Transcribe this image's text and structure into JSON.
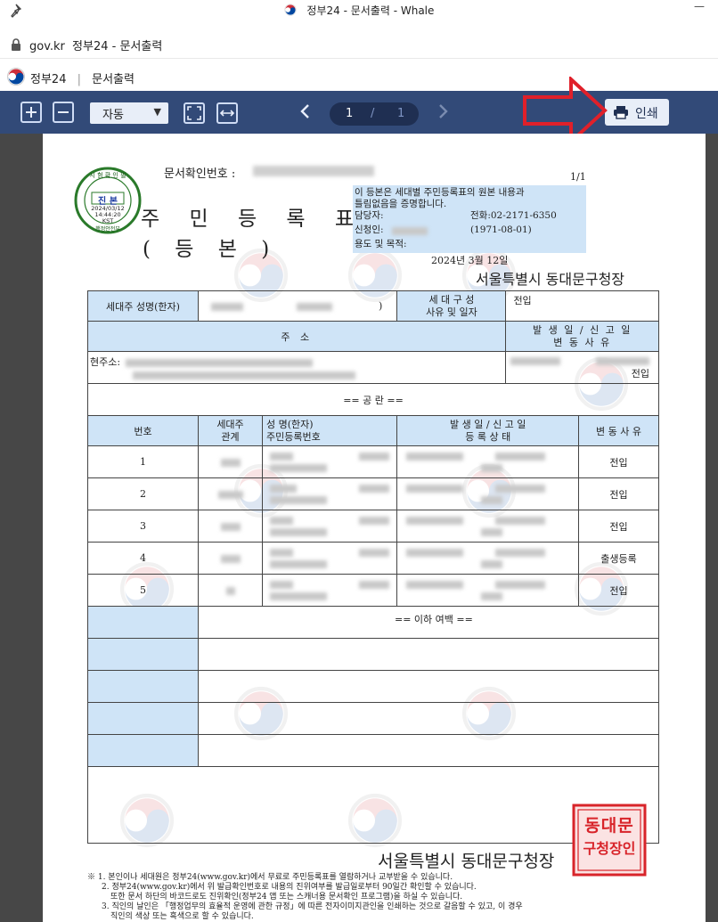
{
  "window": {
    "title": "정부24 - 문서출력 - Whale",
    "minimize": "—"
  },
  "address_bar": {
    "url": "gov.kr",
    "page_title": "정부24 - 문서출력"
  },
  "app_header": {
    "site": "정부24",
    "section": "문서출력"
  },
  "toolbar": {
    "zoom_value": "자동",
    "page_current": "1",
    "page_separator": "/",
    "page_total": "1",
    "print_label": "인쇄",
    "highlight_color": "#e0202a"
  },
  "document": {
    "doc_no_label": "문서확인번호 :",
    "page_count": "1/1",
    "title": "주 민 등 록 표",
    "subtitle": "( 등        본 )",
    "seal_round": {
      "l1": "시 험 확 인 필",
      "l2": "진 본",
      "l3": "2024/03/12",
      "l4": "14:44:20",
      "l5": "KST",
      "l6": "행정안전부"
    },
    "cert_text_1": "이 등본은 세대별 주민등록표의 원본 내용과",
    "cert_text_2": "틀림없음을 증명합니다.",
    "staff_label": "담당자:",
    "phone_label": "전화:02-2171-6350",
    "applicant_label": "신청인:",
    "applicant_birth": "(1971-08-01)",
    "purpose_label": "용도 및 목적:",
    "issue_date": "2024년 3월 12일",
    "office": "서울특별시 동대문구청장",
    "head_name_label": "세대주 성명(한자)",
    "head_name_paren": ")",
    "household_reason_label_1": "세 대 구 성",
    "household_reason_label_2": "사유 및 일자",
    "household_reason_value": "전입",
    "address_header": "주          소",
    "address_date_header_1": "발 생 일  /  신 고 일",
    "address_date_header_2": "변   동    사   유",
    "current_address_label": "현주소:",
    "address_reason_tail": "전입",
    "empty_row_text": "==  공    란  ==",
    "members_header": {
      "no": "번호",
      "relation_1": "세대주",
      "relation_2": "관계",
      "name_1": "성  명(한자)",
      "name_2": "주민등록번호",
      "date_1": "발 생 일  /  신 고 일",
      "date_2": "등 록 상 태",
      "reason": "변 동 사 유"
    },
    "members": [
      {
        "no": "1",
        "reason": "전입"
      },
      {
        "no": "2",
        "reason": "전입"
      },
      {
        "no": "3",
        "reason": "전입"
      },
      {
        "no": "4",
        "reason": "출생등록"
      },
      {
        "no": "5",
        "reason": "전입"
      }
    ],
    "end_marker": "== 이하 여백 ==",
    "red_seal_text_1": "동대문",
    "red_seal_text_2": "구청장인",
    "notes": [
      "※ 1. 본인이나 세대원은 정부24(www.gov.kr)에서 무료로 주민등록표를 열람하거나 교부받을 수 있습니다.",
      "2. 정부24(www.gov.kr)에서 위 발급확인번호로 내용의 진위여부를 발급일로부터 90일간 확인할 수 있습니다.",
      "또한 문서 하단의 바코드로도 진위확인(정부24 앱 또는 스캐너용 문서확인 프로그램)을 하실 수 있습니다.",
      "3. 직인의 날인은 「행정업무의 효율적 운영에 관한 규정」에 따른 전자이미지관인을 인쇄하는 것으로 갈음할 수 있고, 이 경우",
      "직인의 색상 또는 흑색으로 할 수 있습니다."
    ]
  }
}
